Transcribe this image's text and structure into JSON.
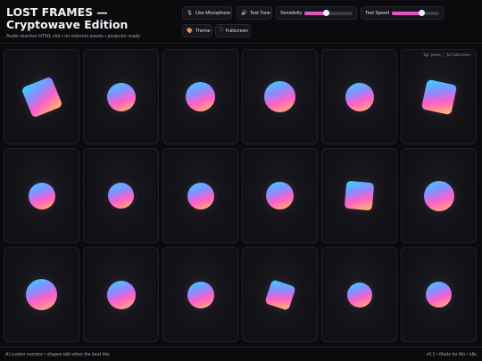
{
  "app": {
    "title": "LOST FRAMES — Cryptowave Edition",
    "subtitle": "Audio-reactive HTML slot • no external assets • projector-ready"
  },
  "controls": {
    "mic_label": "Use Microphone",
    "test_tone_label": "Test Tone",
    "sensitivity_label": "Sensitivity",
    "sensitivity_value": 0.45,
    "text_speed_label": "Text Speed",
    "text_speed_value": 0.62,
    "theme_label": "Theme",
    "fullscreen_label": "Fullscreen",
    "icons": {
      "mic": "microphone-icon",
      "tone": "speaker-icon",
      "theme": "palette-icon",
      "fullscreen": "expand-icon"
    }
  },
  "grid": {
    "tip": "Tip: press ⬚ for fullscreen",
    "gradient": [
      "#2fd8ff",
      "#8a8cff",
      "#ff5fc8",
      "#ffc15e"
    ],
    "tiles": [
      {
        "shape": "square",
        "rotation": -22
      },
      {
        "shape": "circle"
      },
      {
        "shape": "circle"
      },
      {
        "shape": "circle"
      },
      {
        "shape": "circle"
      },
      {
        "shape": "square",
        "rotation": 12
      },
      {
        "shape": "circle"
      },
      {
        "shape": "circle"
      },
      {
        "shape": "circle"
      },
      {
        "shape": "circle"
      },
      {
        "shape": "square",
        "rotation": 5
      },
      {
        "shape": "circle"
      },
      {
        "shape": "circle"
      },
      {
        "shape": "circle"
      },
      {
        "shape": "circle"
      },
      {
        "shape": "square",
        "rotation": 18
      },
      {
        "shape": "circle"
      },
      {
        "shape": "circle"
      }
    ]
  },
  "footer": {
    "left": "AI curator narrator • shapes talk when the beat hits",
    "right": "v0.1 • Made for Mo • idle"
  }
}
